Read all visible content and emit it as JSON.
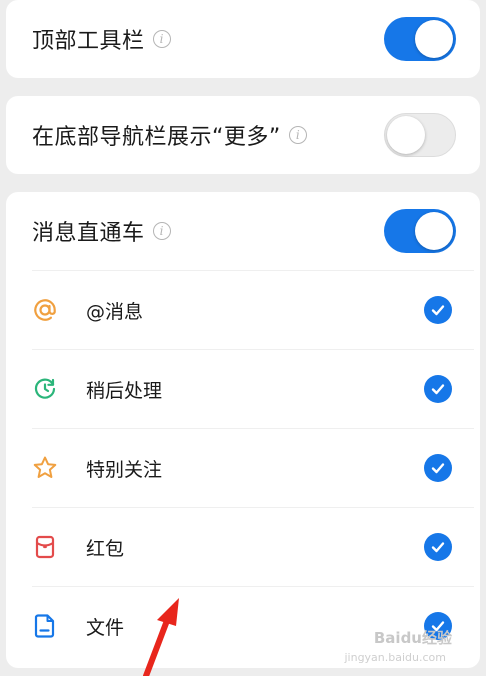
{
  "settings": {
    "top_toolbar": {
      "label": "顶部工具栏",
      "state": "on"
    },
    "bottom_nav_more": {
      "label": "在底部导航栏展示“更多”",
      "state": "off"
    },
    "message_express": {
      "label": "消息直通车",
      "state": "on"
    }
  },
  "express_items": [
    {
      "label": "@消息",
      "icon": "at-icon",
      "checked": true
    },
    {
      "label": "稍后处理",
      "icon": "clock-later-icon",
      "checked": true
    },
    {
      "label": "特别关注",
      "icon": "star-icon",
      "checked": true
    },
    {
      "label": "红包",
      "icon": "red-envelope-icon",
      "checked": true
    },
    {
      "label": "文件",
      "icon": "file-icon",
      "checked": true
    }
  ],
  "watermark": {
    "text": "Baidu经验",
    "sub": "jingyan.baidu.com"
  },
  "colors": {
    "accent": "#1677e8",
    "at": "#f0a040",
    "later": "#2bb57a",
    "star": "#f0a040",
    "envelope": "#e34b4b",
    "file": "#1677e8",
    "arrow": "#e8261c"
  }
}
